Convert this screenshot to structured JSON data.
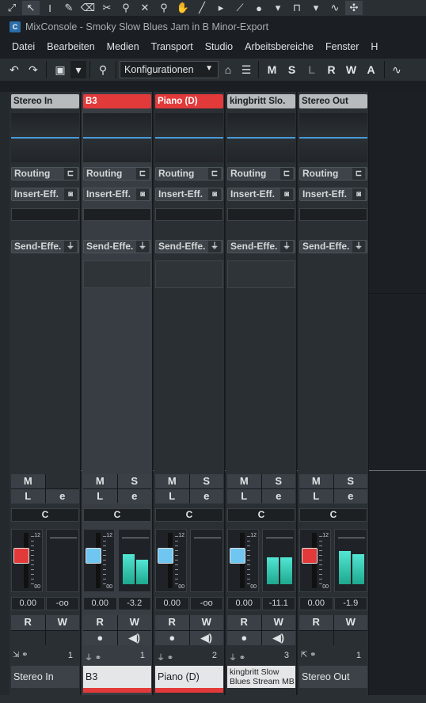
{
  "toolbar_top": {
    "icons": [
      "pointer-icon",
      "range-icon",
      "pencil-icon",
      "eraser-icon",
      "scissors-icon",
      "glue-icon",
      "mute-icon",
      "zoom-icon",
      "hand-icon",
      "line-icon",
      "play-icon",
      "drumstick-icon",
      "dropdown-icon",
      "snap-icon",
      "dropdown-icon",
      "curve-icon",
      "snap-grid-icon"
    ]
  },
  "window": {
    "title": "MixConsole - Smoky Slow Blues Jam in B Minor-Export"
  },
  "menu": [
    "Datei",
    "Bearbeiten",
    "Medien",
    "Transport",
    "Studio",
    "Arbeitsbereiche",
    "Fenster",
    "H"
  ],
  "toolbar2": {
    "configurations": "Konfigurationen",
    "msl": [
      {
        "l": "M",
        "dim": false
      },
      {
        "l": "S",
        "dim": false
      },
      {
        "l": "L",
        "dim": true
      },
      {
        "l": "R",
        "dim": false
      },
      {
        "l": "W",
        "dim": false
      },
      {
        "l": "A",
        "dim": false
      }
    ]
  },
  "strip_labels": {
    "routing": "Routing",
    "insert": "Insert-Eff.",
    "send": "Send-Effe.",
    "m": "M",
    "s": "S",
    "l": "L",
    "e": "e",
    "pan": "C",
    "r": "R",
    "w": "W",
    "scale_top": "12",
    "scale_bottom": "00"
  },
  "channels": [
    {
      "name": "Stereo In",
      "name_bottom": "Stereo In",
      "header": "grey",
      "volume": "0.00",
      "meter": "-oo",
      "number": "1",
      "has_solo": false,
      "selected": false,
      "fader_color": "#e23a3a",
      "fader_level": 0.62,
      "meter_levels": [
        0,
        0
      ],
      "bottom_style": "dark",
      "red_line": false,
      "icon": "input-icon"
    },
    {
      "name": "B3",
      "name_bottom": "B3",
      "header": "red",
      "volume": "0.00",
      "meter": "-3.2",
      "number": "1",
      "has_solo": true,
      "selected": true,
      "fader_color": "#6fc6f0",
      "fader_level": 0.62,
      "meter_levels": [
        0.62,
        0.5
      ],
      "bottom_style": "light",
      "red_line": true,
      "icon": "audio-icon"
    },
    {
      "name": "Piano (D)",
      "name_bottom": "Piano (D)",
      "header": "red",
      "volume": "0.00",
      "meter": "-oo",
      "number": "2",
      "has_solo": true,
      "selected": false,
      "fader_color": "#6fc6f0",
      "fader_level": 0.62,
      "meter_levels": [
        0,
        0
      ],
      "bottom_style": "light",
      "red_line": true,
      "icon": "audio-icon"
    },
    {
      "name": "kingbritt Slo.",
      "name_bottom": "kingbritt Slow Blues Stream MB",
      "header": "grey",
      "volume": "0.00",
      "meter": "-11.1",
      "number": "3",
      "has_solo": true,
      "selected": false,
      "fader_color": "#6fc6f0",
      "fader_level": 0.62,
      "meter_levels": [
        0.55,
        0.55
      ],
      "bottom_style": "light",
      "red_line": false,
      "icon": "audio-icon"
    },
    {
      "name": "Stereo Out",
      "name_bottom": "Stereo Out",
      "header": "grey",
      "volume": "0.00",
      "meter": "-1.9",
      "number": "1",
      "has_solo": true,
      "selected": false,
      "fader_color": "#e23a3a",
      "fader_level": 0.62,
      "meter_levels": [
        0.68,
        0.62
      ],
      "bottom_style": "dark",
      "red_line": false,
      "icon": "output-icon"
    }
  ]
}
